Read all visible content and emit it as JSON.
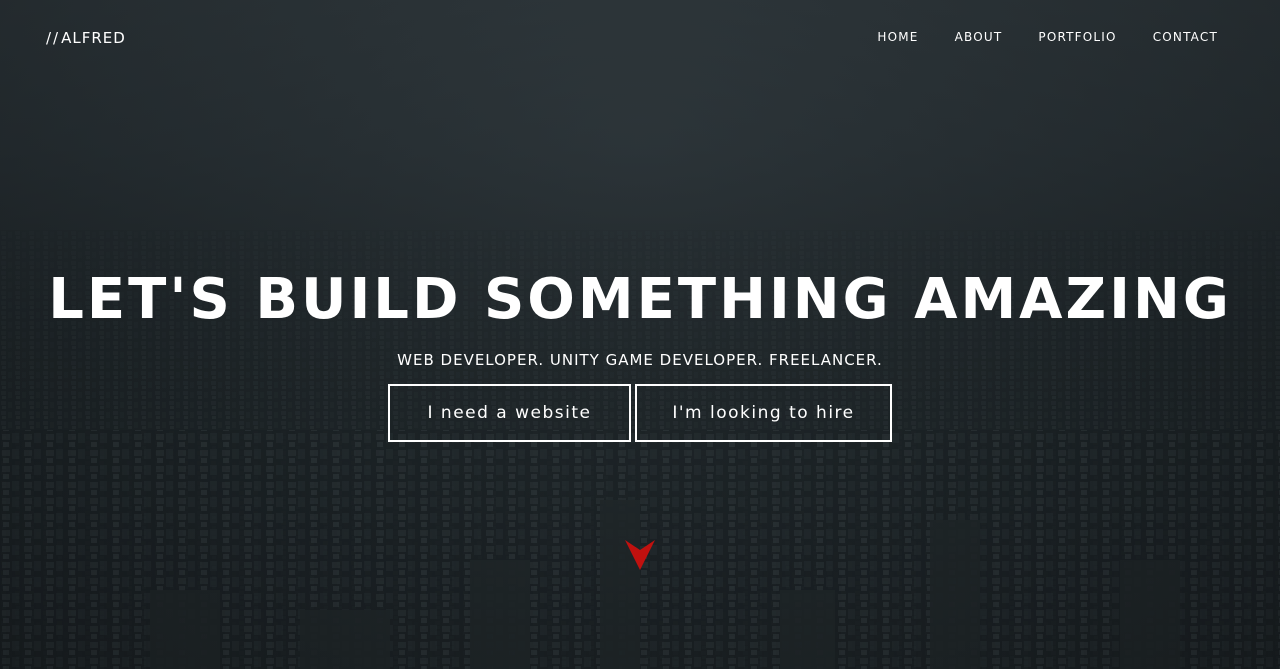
{
  "header": {
    "logo_slashes": "//",
    "logo_text": "ALFRED",
    "nav": [
      {
        "label": "HOME"
      },
      {
        "label": "ABOUT"
      },
      {
        "label": "PORTFOLIO"
      },
      {
        "label": "CONTACT"
      }
    ]
  },
  "hero": {
    "headline": "LET'S BUILD SOMETHING AMAZING",
    "subheadline": "WEB DEVELOPER. UNITY GAME DEVELOPER. FREELANCER.",
    "buttons": {
      "website_label": "I need a website",
      "hire_label": "I'm looking to hire"
    },
    "scroll_icon": "chevron-down-icon"
  },
  "colors": {
    "accent": "#c0110f",
    "text": "#ffffff",
    "background": "#1f2629"
  }
}
